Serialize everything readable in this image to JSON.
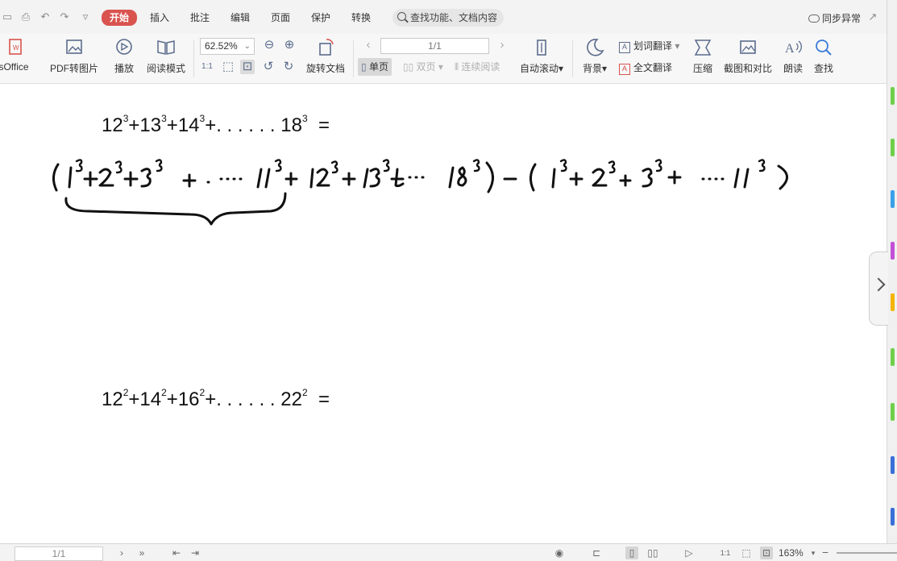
{
  "menubar": {
    "tabs": [
      "开始",
      "插入",
      "批注",
      "编辑",
      "页面",
      "保护",
      "转换"
    ],
    "active_tab": "开始",
    "search_placeholder": "查找功能、文档内容",
    "sync_label": "同步异常",
    "active_color": "#d9534f"
  },
  "ribbon": {
    "office_label": "sOffice",
    "pdf_to_image": "PDF转图片",
    "play": "播放",
    "read_mode": "阅读模式",
    "zoom_value": "62.52%",
    "rotate_doc": "旋转文档",
    "page_value": "1/1",
    "single_page": "单页",
    "double_page": "双页",
    "continuous_read": "连续阅读",
    "auto_scroll": "自动滚动",
    "background": "背景",
    "word_translate": "划词翻译",
    "full_translate": "全文翻译",
    "compress": "压缩",
    "screenshot_compare": "截图和对比",
    "read_aloud": "朗读",
    "find": "查找"
  },
  "document": {
    "eq1": {
      "b1": "12",
      "e1": "3",
      "b2": "+13",
      "e2": "3",
      "b3": "+14",
      "e3": "3",
      "tail": "+. . . . . . 18",
      "e4": "3",
      "eqs": "  ="
    },
    "eq2": {
      "b1": "12",
      "e1": "2",
      "b2": "+14",
      "e2": "2",
      "b3": "+16",
      "e3": "2",
      "tail": "+. . . . . . 22",
      "e4": "2",
      "eqs": "  ="
    }
  },
  "statusbar": {
    "page_value": "1/1",
    "zoom_percent": "163%"
  }
}
